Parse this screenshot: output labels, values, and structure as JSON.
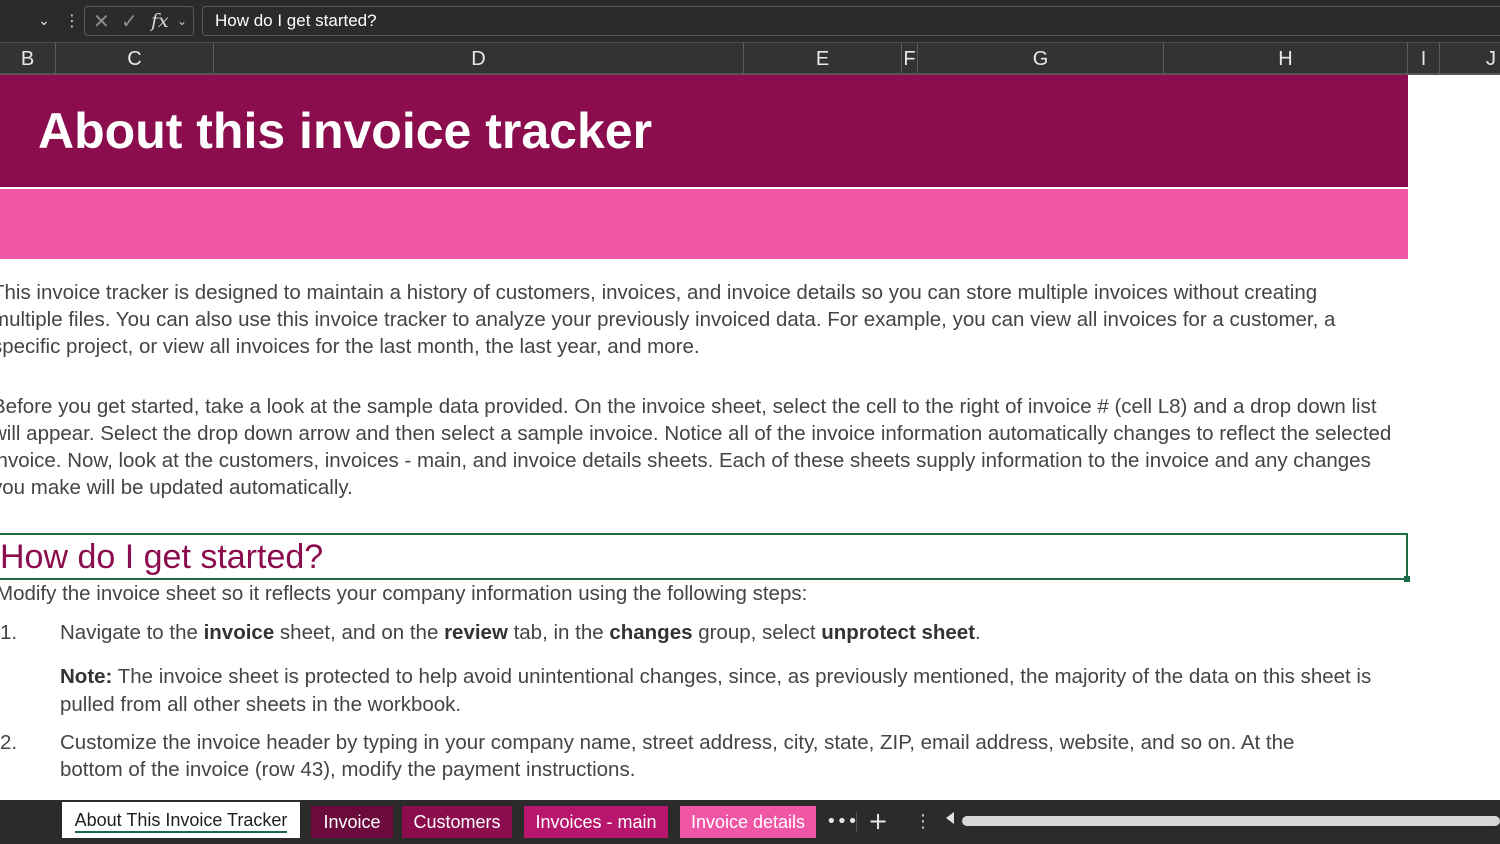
{
  "formula_bar": {
    "namebox_dropdown_icon": "chevron-down-icon",
    "content": "How do I get started?"
  },
  "columns": [
    "B",
    "C",
    "D",
    "E",
    "F",
    "G",
    "H",
    "I",
    "J"
  ],
  "sheet": {
    "title": "About this invoice tracker",
    "paragraph1": "This invoice tracker is designed to maintain a history of customers, invoices, and invoice details so you can store multiple invoices without creating multiple files. You can also use this invoice tracker to analyze your previously invoiced data. For example, you can view all invoices for a customer, a specific project, or view all invoices for the last month, the last year, and more.",
    "paragraph2": "Before you get started, take a look at the sample data provided. On the invoice sheet, select the cell to the right of invoice # (cell L8) and a drop down list will appear. Select the drop down arrow and then select a sample invoice. Notice all of the invoice information automatically changes to reflect the selected invoice. Now, look at the customers, invoices - main, and invoice details sheets. Each of these sheets supply information to the invoice and any changes you make will be updated automatically.",
    "heading": "How do I get started?",
    "intro": "Modify the invoice sheet so it reflects your company information using the following steps:",
    "steps": [
      {
        "num": "1.",
        "parts": [
          "Navigate to the ",
          "invoice",
          " sheet, and on the ",
          "review",
          " tab, in the ",
          "changes",
          " group, select ",
          "unprotect sheet",
          "."
        ]
      },
      {
        "num": "2.",
        "text": "Customize the invoice header by typing in your company name, street address, city, state, ZIP, email address, website, and so on. At the bottom of the invoice (row 43), modify the payment instructions."
      }
    ],
    "note_label": "Note:",
    "note_text": " The invoice sheet is protected to help avoid unintentional changes, since, as previously mentioned, the majority of the data on this sheet is pulled from all other sheets in the workbook."
  },
  "tabs": [
    {
      "label": "About This Invoice Tracker",
      "active": true,
      "color": "#ffffff"
    },
    {
      "label": "Invoice",
      "color": "#6b0a3c"
    },
    {
      "label": "Customers",
      "color": "#8b0d4e"
    },
    {
      "label": "Invoices - main",
      "color": "#b8166d"
    },
    {
      "label": "Invoice details",
      "color": "#ef56a5"
    }
  ],
  "colors": {
    "banner": "#8b0d4e",
    "accent_bar": "#ef56a5",
    "selection": "#1e6b46"
  }
}
